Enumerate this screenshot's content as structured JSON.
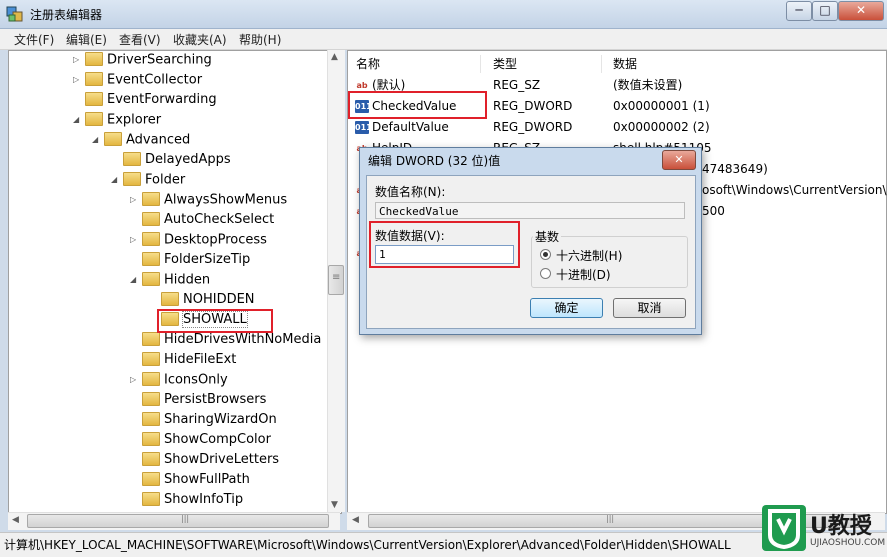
{
  "window": {
    "title": "注册表编辑器",
    "min": "─",
    "max": "□",
    "close": "✕"
  },
  "menu": [
    "文件(F)",
    "编辑(E)",
    "查看(V)",
    "收藏夹(A)",
    "帮助(H)"
  ],
  "tree": {
    "nodes": [
      {
        "label": "DriverSearching",
        "expander": "▷"
      },
      {
        "label": "EventCollector",
        "expander": "▷"
      },
      {
        "label": "EventForwarding",
        "expander": ""
      },
      {
        "label": "Explorer",
        "expander": "◢"
      },
      {
        "label": "Advanced",
        "expander": "◢"
      },
      {
        "label": "DelayedApps",
        "expander": ""
      },
      {
        "label": "Folder",
        "expander": "◢"
      },
      {
        "label": "AlwaysShowMenus",
        "expander": "▷"
      },
      {
        "label": "AutoCheckSelect",
        "expander": ""
      },
      {
        "label": "DesktopProcess",
        "expander": "▷"
      },
      {
        "label": "FolderSizeTip",
        "expander": ""
      },
      {
        "label": "Hidden",
        "expander": "◢"
      },
      {
        "label": "NOHIDDEN",
        "expander": ""
      },
      {
        "label": "SHOWALL",
        "expander": ""
      },
      {
        "label": "HideDrivesWithNoMedia",
        "expander": ""
      },
      {
        "label": "HideFileExt",
        "expander": ""
      },
      {
        "label": "IconsOnly",
        "expander": "▷"
      },
      {
        "label": "PersistBrowsers",
        "expander": ""
      },
      {
        "label": "SharingWizardOn",
        "expander": ""
      },
      {
        "label": "ShowCompColor",
        "expander": ""
      },
      {
        "label": "ShowDriveLetters",
        "expander": ""
      },
      {
        "label": "ShowFullPath",
        "expander": ""
      },
      {
        "label": "ShowInfoTip",
        "expander": ""
      }
    ],
    "scroll_grip": "≡",
    "hscroll_grip": "|||"
  },
  "list": {
    "headers": {
      "name": "名称",
      "type": "类型",
      "data": "数据"
    },
    "rows": [
      {
        "icon": "string-value-icon",
        "name": "(默认)",
        "type": "REG_SZ",
        "data": "(数值未设置)"
      },
      {
        "icon": "dword-value-icon",
        "name": "CheckedValue",
        "type": "REG_DWORD",
        "data": "0x00000001 (1)"
      },
      {
        "icon": "dword-value-icon",
        "name": "DefaultValue",
        "type": "REG_DWORD",
        "data": "0x00000002 (2)"
      },
      {
        "icon": "string-value-icon",
        "name": "HelpID",
        "type": "REG_SZ",
        "data": "shell.hlp#51105"
      }
    ],
    "partial_data": [
      "47483649)",
      "osoft\\Windows\\CurrentVersion\\...",
      "500"
    ],
    "hscroll_grip": "|||"
  },
  "dialog": {
    "title": "编辑 DWORD (32 位)值",
    "close": "✕",
    "name_label": "数值名称(N):",
    "name_value": "CheckedValue",
    "data_label": "数值数据(V):",
    "data_value": "1",
    "base_label": "基数",
    "radio_hex": "十六进制(H)",
    "radio_dec": "十进制(D)",
    "selected_base": "hex",
    "ok": "确定",
    "cancel": "取消"
  },
  "status": "计算机\\HKEY_LOCAL_MACHINE\\SOFTWARE\\Microsoft\\Windows\\CurrentVersion\\Explorer\\Advanced\\Folder\\Hidden\\SHOWALL",
  "watermark": {
    "name": "U教授",
    "url": "UJIAOSHOU.COM"
  },
  "colors": {
    "highlight_box": "#e0202a",
    "title_gradient": "#c3d3e6",
    "watermark": "#1f9b4f"
  }
}
